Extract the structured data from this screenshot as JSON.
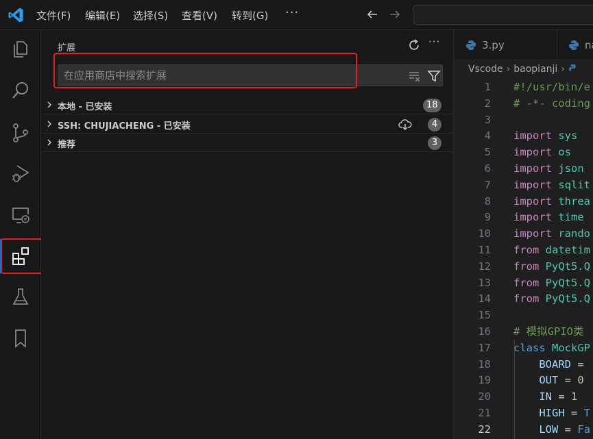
{
  "titlebar": {
    "menu": [
      "文件(F)",
      "编辑(E)",
      "选择(S)",
      "查看(V)",
      "转到(G)"
    ],
    "more": "···"
  },
  "sidebar": {
    "title": "扩展",
    "more": "···",
    "search_placeholder": "在应用商店中搜索扩展",
    "sections": [
      {
        "label": "本地 - 已安装",
        "count": "18"
      },
      {
        "label": "SSH: CHUJIACHENG - 已安装",
        "count": "4"
      },
      {
        "label": "推荐",
        "count": "3"
      }
    ]
  },
  "editor": {
    "tabs": [
      "3.py",
      "na"
    ],
    "breadcrumb": [
      "Vscode",
      "baopianji"
    ],
    "active_line": "22",
    "lines": [
      {
        "n": "1",
        "tokens": [
          {
            "t": "#!/usr/bin/e",
            "c": "cm"
          }
        ]
      },
      {
        "n": "2",
        "tokens": [
          {
            "t": "# -*- coding",
            "c": "cm"
          }
        ]
      },
      {
        "n": "3",
        "tokens": []
      },
      {
        "n": "4",
        "tokens": [
          {
            "t": "import",
            "c": "kw"
          },
          {
            "t": " sys",
            "c": "mod"
          }
        ]
      },
      {
        "n": "5",
        "tokens": [
          {
            "t": "import",
            "c": "kw"
          },
          {
            "t": " os",
            "c": "mod"
          }
        ]
      },
      {
        "n": "6",
        "tokens": [
          {
            "t": "import",
            "c": "kw"
          },
          {
            "t": " json",
            "c": "mod"
          }
        ]
      },
      {
        "n": "7",
        "tokens": [
          {
            "t": "import",
            "c": "kw"
          },
          {
            "t": " sqlit",
            "c": "mod"
          }
        ]
      },
      {
        "n": "8",
        "tokens": [
          {
            "t": "import",
            "c": "kw"
          },
          {
            "t": " threa",
            "c": "mod"
          }
        ]
      },
      {
        "n": "9",
        "tokens": [
          {
            "t": "import",
            "c": "kw"
          },
          {
            "t": " time",
            "c": "mod"
          }
        ]
      },
      {
        "n": "10",
        "tokens": [
          {
            "t": "import",
            "c": "kw"
          },
          {
            "t": " rando",
            "c": "mod"
          }
        ]
      },
      {
        "n": "11",
        "tokens": [
          {
            "t": "from",
            "c": "kw"
          },
          {
            "t": " datetim",
            "c": "mod"
          }
        ]
      },
      {
        "n": "12",
        "tokens": [
          {
            "t": "from",
            "c": "kw"
          },
          {
            "t": " PyQt5",
            "c": "mod"
          },
          {
            "t": ".Q",
            "c": "mod"
          }
        ]
      },
      {
        "n": "13",
        "tokens": [
          {
            "t": "from",
            "c": "kw"
          },
          {
            "t": " PyQt5",
            "c": "mod"
          },
          {
            "t": ".Q",
            "c": "mod"
          }
        ]
      },
      {
        "n": "14",
        "tokens": [
          {
            "t": "from",
            "c": "kw"
          },
          {
            "t": " PyQt5",
            "c": "mod"
          },
          {
            "t": ".Q",
            "c": "mod"
          }
        ]
      },
      {
        "n": "15",
        "tokens": []
      },
      {
        "n": "16",
        "tokens": [
          {
            "t": "# 模拟GPIO类",
            "c": "cm"
          }
        ]
      },
      {
        "n": "17",
        "tokens": [
          {
            "t": "class",
            "c": "kw2"
          },
          {
            "t": " MockGP",
            "c": "mod"
          }
        ]
      },
      {
        "n": "18",
        "tokens": [
          {
            "t": "    BOARD",
            "c": "var"
          },
          {
            "t": " =",
            "c": "op"
          }
        ]
      },
      {
        "n": "19",
        "tokens": [
          {
            "t": "    OUT",
            "c": "var"
          },
          {
            "t": " = ",
            "c": "op"
          },
          {
            "t": "0",
            "c": "num"
          }
        ]
      },
      {
        "n": "20",
        "tokens": [
          {
            "t": "    IN",
            "c": "var"
          },
          {
            "t": " = ",
            "c": "op"
          },
          {
            "t": "1",
            "c": "num"
          }
        ]
      },
      {
        "n": "21",
        "tokens": [
          {
            "t": "    HIGH",
            "c": "var"
          },
          {
            "t": " = ",
            "c": "op"
          },
          {
            "t": "T",
            "c": "kw2"
          }
        ]
      },
      {
        "n": "22",
        "tokens": [
          {
            "t": "    LOW",
            "c": "var"
          },
          {
            "t": " = ",
            "c": "op"
          },
          {
            "t": "Fa",
            "c": "kw2"
          }
        ]
      }
    ]
  }
}
